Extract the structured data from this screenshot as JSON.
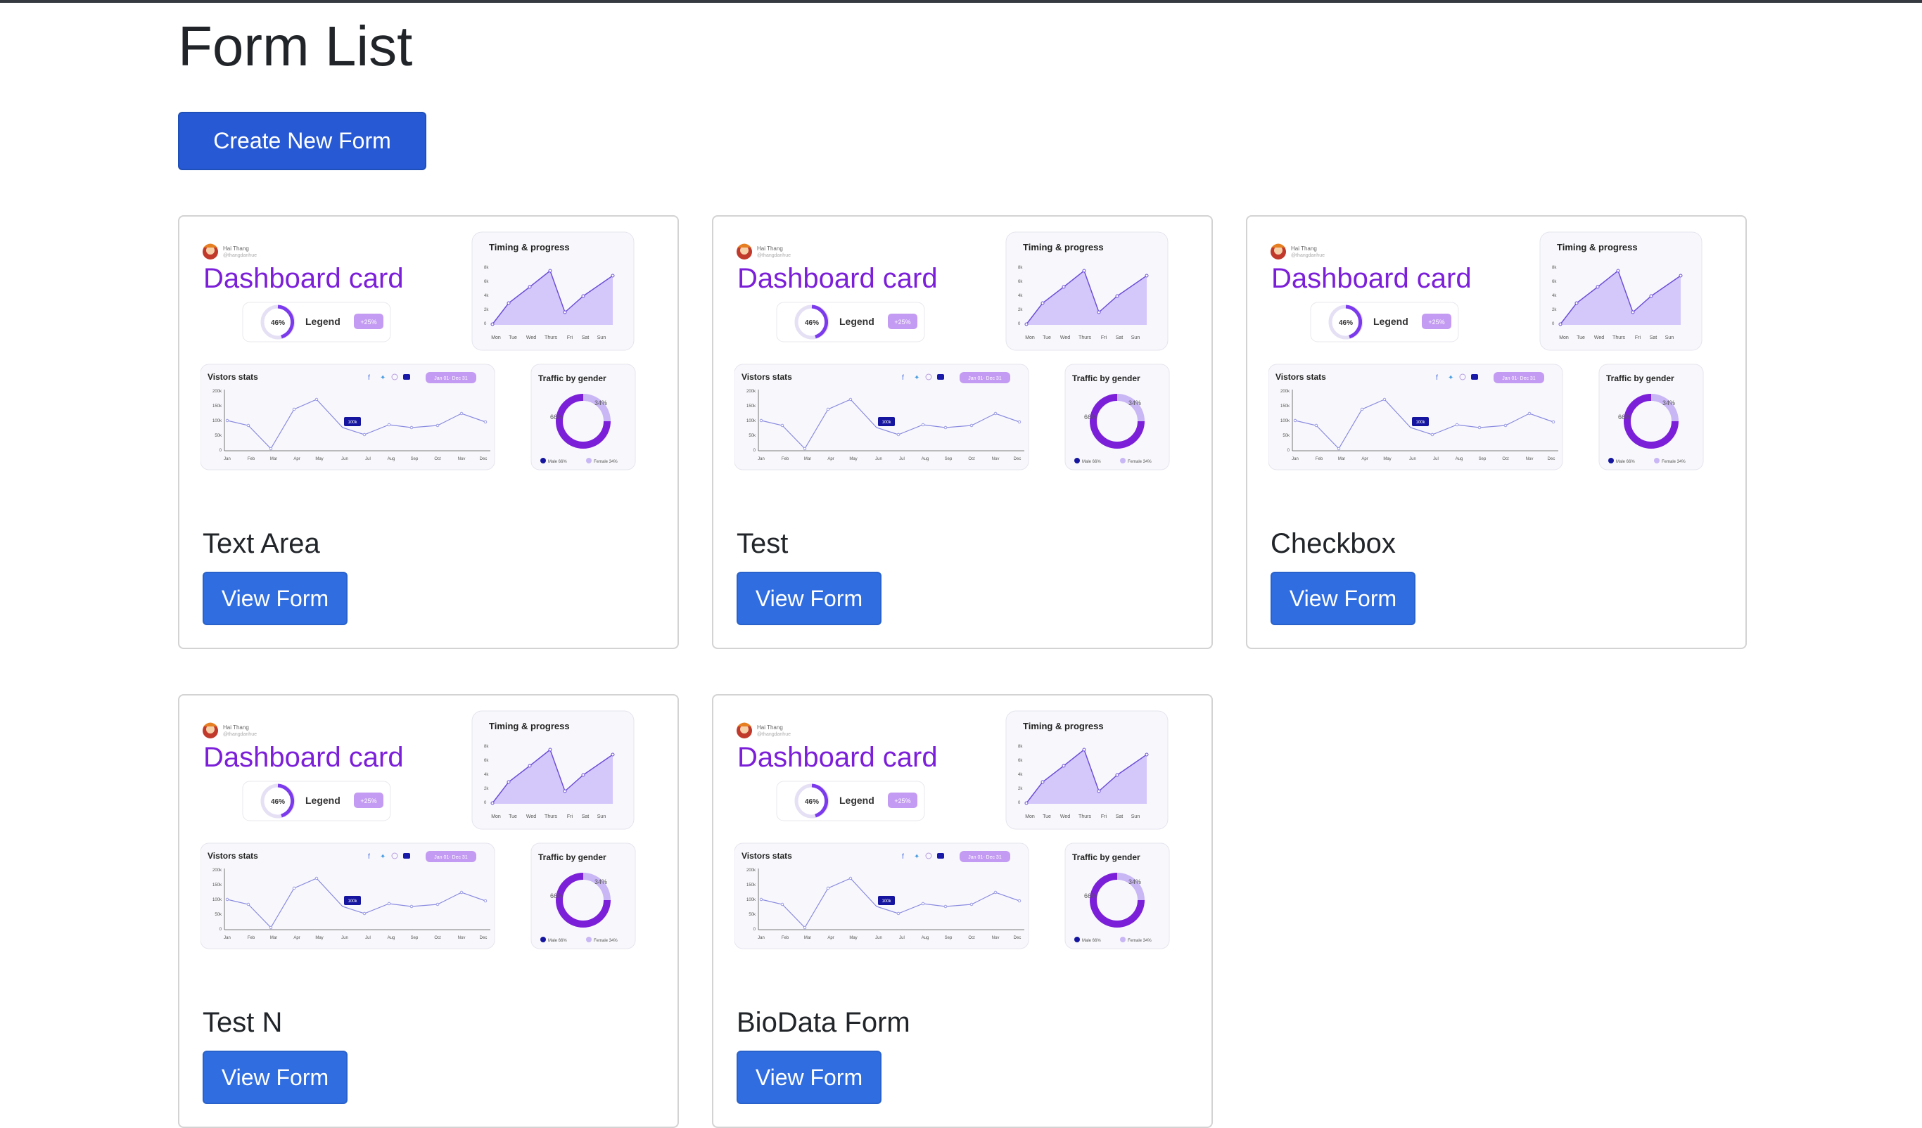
{
  "page": {
    "title": "Form List"
  },
  "toolbar": {
    "create_label": "Create New Form"
  },
  "thumbnail": {
    "user_name": "Hai Thang",
    "user_handle": "@thangdanhue",
    "title": "Dashboard card",
    "progress_pct": "46%",
    "legend_label": "Legend",
    "legend_badge": "+25%",
    "timing_title": "Timing & progress",
    "timing_days": [
      "Mon",
      "Tue",
      "Wed",
      "Thurs",
      "Fri",
      "Sat",
      "Sun"
    ],
    "visitors_title": "Vistors stats",
    "date_range": "Jan 01- Dec 31",
    "visitors_months": [
      "Jan",
      "Feb",
      "Mar",
      "Apr",
      "May",
      "Jun",
      "Jul",
      "Aug",
      "Sep",
      "Oct",
      "Nov",
      "Dec"
    ],
    "visitors_y_ticks": [
      "200k",
      "150k",
      "100k",
      "50k",
      "0"
    ],
    "highlight_label": "100k",
    "traffic_title": "Traffic by gender",
    "female_pct": "34%",
    "male_pct": "66%",
    "legend_male": "Male 66%",
    "legend_female": "Female 34%",
    "colors": {
      "purple": "#7c1fd9",
      "navy": "#1515a0",
      "lavender": "#c9b6f5"
    }
  },
  "forms": [
    {
      "title": "Text Area",
      "button_label": "View Form"
    },
    {
      "title": "Test",
      "button_label": "View Form"
    },
    {
      "title": "Checkbox",
      "button_label": "View Form"
    },
    {
      "title": "Test N",
      "button_label": "View Form"
    },
    {
      "title": "BioData Form",
      "button_label": "View Form"
    }
  ]
}
